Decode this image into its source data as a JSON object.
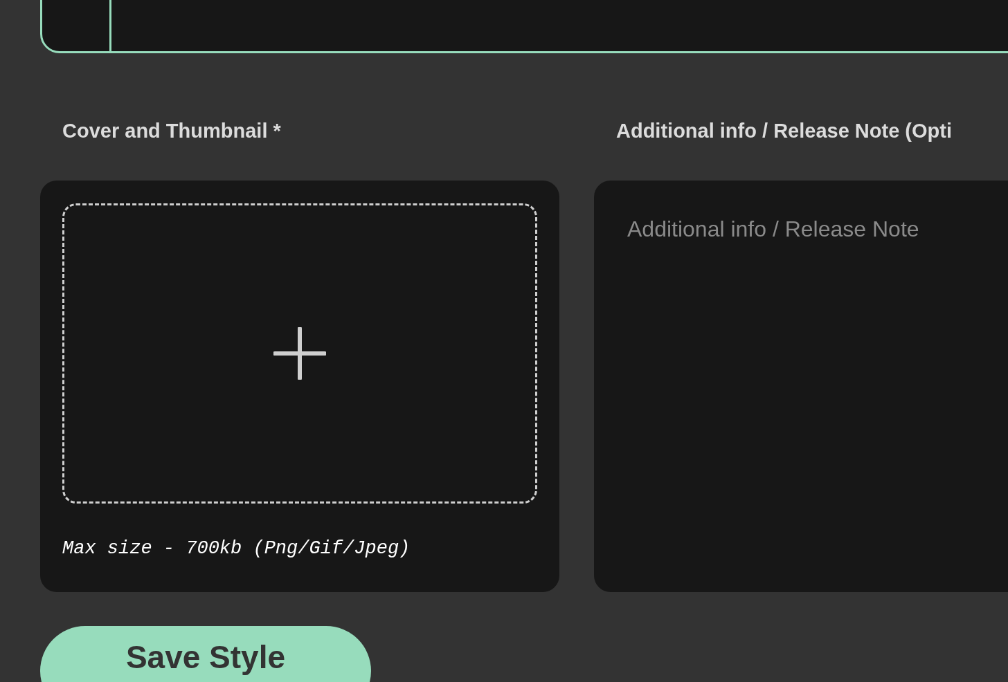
{
  "cover": {
    "label": "Cover and Thumbnail *",
    "hint": "Max size - 700kb (Png/Gif/Jpeg)"
  },
  "notes": {
    "label": "Additional info / Release Note (Opti",
    "placeholder": "Additional info / Release Note"
  },
  "buttons": [
    "Save Style"
  ]
}
